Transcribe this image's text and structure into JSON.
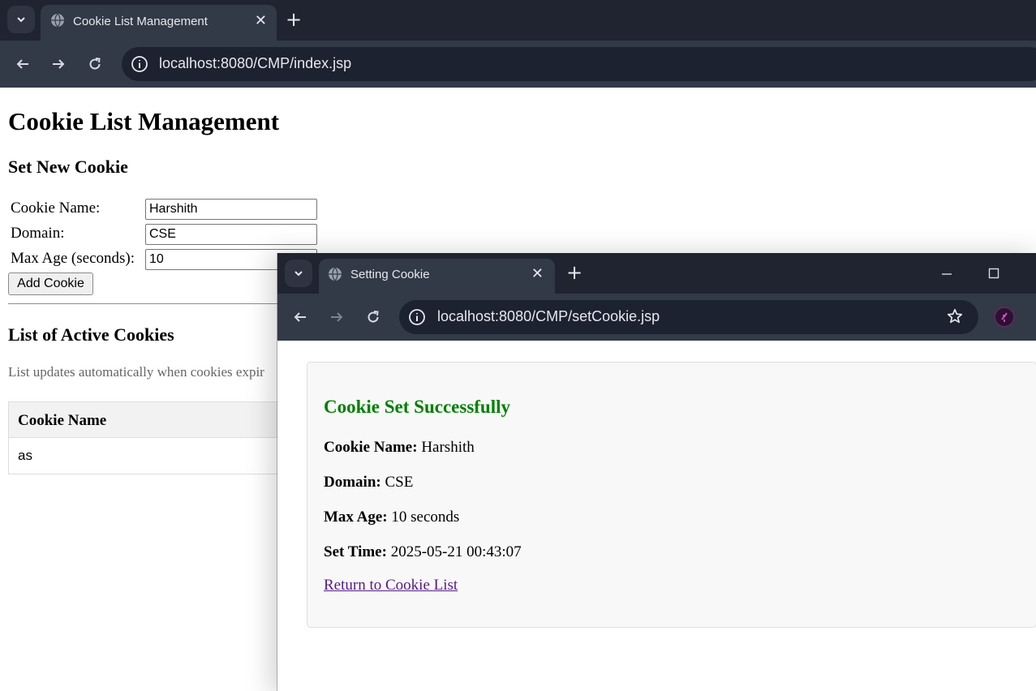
{
  "back_window": {
    "tab_title": "Cookie List Management",
    "url": "localhost:8080/CMP/index.jsp"
  },
  "page": {
    "title": "Cookie List Management",
    "set_heading": "Set New Cookie",
    "form": {
      "name_label": "Cookie Name:",
      "name_value": "Harshith",
      "domain_label": "Domain:",
      "domain_value": "CSE",
      "maxage_label": "Max Age (seconds):",
      "maxage_value": "10",
      "submit_label": "Add Cookie"
    },
    "list_heading": "List of Active Cookies",
    "list_hint": "List updates automatically when cookies expir",
    "table": {
      "header": "Cookie Name",
      "rows": [
        "as"
      ]
    }
  },
  "front_window": {
    "tab_title": "Setting Cookie",
    "url": "localhost:8080/CMP/setCookie.jsp",
    "heading": "Cookie Set Successfully",
    "name_label": "Cookie Name:",
    "name_value": "Harshith",
    "domain_label": "Domain:",
    "domain_value": "CSE",
    "maxage_label": "Max Age:",
    "maxage_value": "10 seconds",
    "settime_label": "Set Time:",
    "settime_value": "2025-05-21 00:43:07",
    "return_link": "Return to Cookie List",
    "success_color": "#008000"
  }
}
